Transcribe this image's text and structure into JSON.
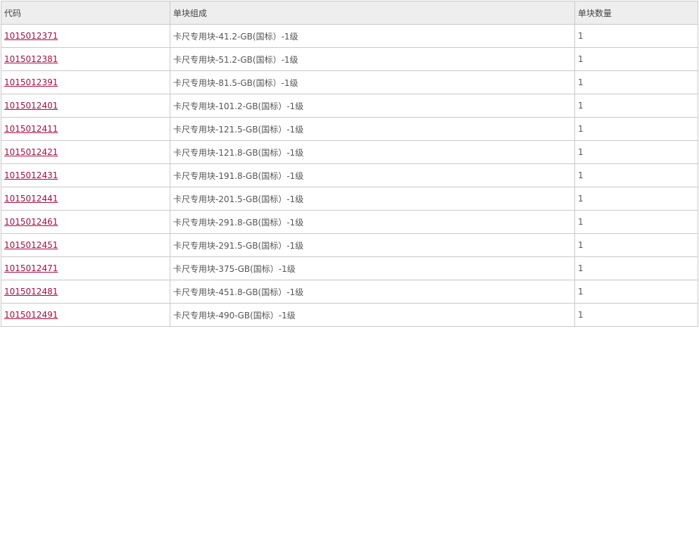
{
  "table": {
    "headers": [
      "代码",
      "单块组成",
      "单块数量"
    ],
    "rows": [
      {
        "code": "1015012371",
        "composition": "卡尺专用块-41.2-GB(国标）-1级",
        "qty": "1"
      },
      {
        "code": "1015012381",
        "composition": "卡尺专用块-51.2-GB(国标）-1级",
        "qty": "1"
      },
      {
        "code": "1015012391",
        "composition": "卡尺专用块-81.5-GB(国标）-1级",
        "qty": "1"
      },
      {
        "code": "1015012401",
        "composition": "卡尺专用块-101.2-GB(国标）-1级",
        "qty": "1"
      },
      {
        "code": "1015012411",
        "composition": "卡尺专用块-121.5-GB(国标）-1级",
        "qty": "1"
      },
      {
        "code": "1015012421",
        "composition": "卡尺专用块-121.8-GB(国标）-1级",
        "qty": "1"
      },
      {
        "code": "1015012431",
        "composition": "卡尺专用块-191.8-GB(国标）-1级",
        "qty": "1"
      },
      {
        "code": "1015012441",
        "composition": "卡尺专用块-201.5-GB(国标）-1级",
        "qty": "1"
      },
      {
        "code": "1015012461",
        "composition": "卡尺专用块-291.8-GB(国标）-1级",
        "qty": "1"
      },
      {
        "code": "1015012451",
        "composition": "卡尺专用块-291.5-GB(国标）-1级",
        "qty": "1"
      },
      {
        "code": "1015012471",
        "composition": "卡尺专用块-375-GB(国标）-1级",
        "qty": "1"
      },
      {
        "code": "1015012481",
        "composition": "卡尺专用块-451.8-GB(国标）-1级",
        "qty": "1"
      },
      {
        "code": "1015012491",
        "composition": "卡尺专用块-490-GB(国标）-1级",
        "qty": "1"
      }
    ]
  },
  "colors": {
    "link": "#a01040",
    "header_bg": "#eeeeee",
    "border": "#c9c9c9",
    "text": "#555555"
  }
}
